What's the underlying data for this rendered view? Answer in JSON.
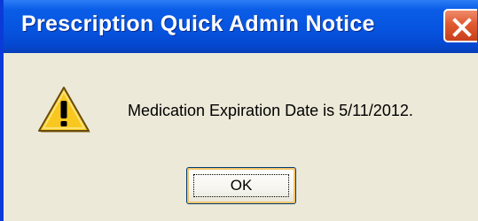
{
  "dialog": {
    "title": "Prescription Quick Admin Notice",
    "message": "Medication Expiration Date is 5/11/2012.",
    "ok_label": "OK",
    "icon": "warning-icon",
    "close_icon": "close-icon"
  },
  "colors": {
    "titlebar": "#0654e0",
    "dialog_background": "#ece9d8",
    "close_button": "#e05a30",
    "warning_fill": "#f8c820"
  }
}
